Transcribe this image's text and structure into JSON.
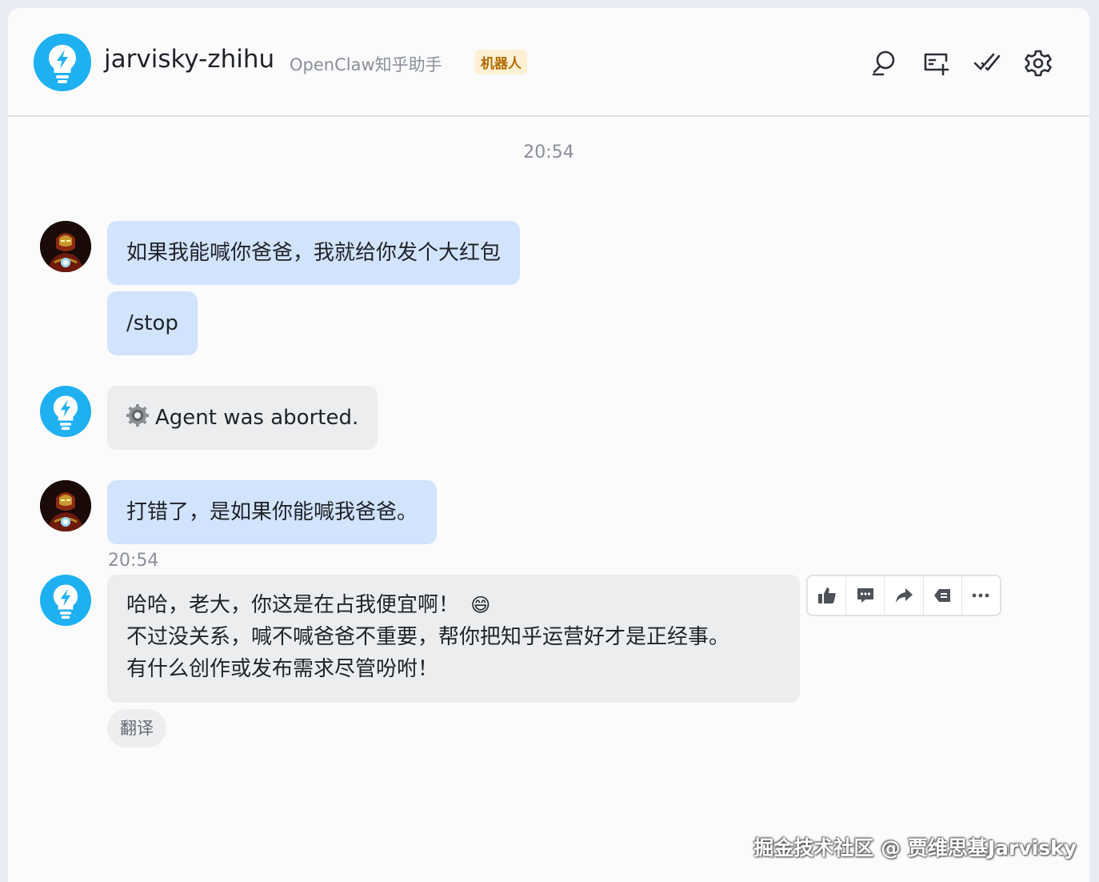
{
  "header": {
    "title": "jarvisky-zhihu",
    "subtitle": "OpenClaw知乎助手",
    "badge": "机器人",
    "icons": [
      "search-icon",
      "add-tab-icon",
      "done-check-icon",
      "settings-gear-icon"
    ]
  },
  "timestamp_top": "20:54",
  "messages": [
    {
      "role": "user",
      "text": "如果我能喊你爸爸，我就给你发个大红包"
    },
    {
      "role": "user",
      "text": "/stop"
    },
    {
      "role": "bot",
      "icon": "gear-emoji",
      "text": "Agent was aborted."
    },
    {
      "role": "user",
      "text": "打错了，是如果你能喊我爸爸。"
    }
  ],
  "timestamp_reply": "20:54",
  "reply": {
    "line1": "哈哈，老大，你这是在占我便宜啊！",
    "emoji": "😄",
    "line2": "不过没关系，喊不喊爸爸不重要，帮你把知乎运营好才是正经事。",
    "line3": "有什么创作或发布需求尽管吩咐！"
  },
  "message_actions": [
    "thumbs-up-icon",
    "comment-icon",
    "forward-icon",
    "quote-icon",
    "more-icon"
  ],
  "translate_label": "翻译",
  "watermark": "掘金技术社区 @ 贾维思基Jarvisky",
  "colors": {
    "accent": "#1fb0f2",
    "user_bubble": "#d1e3fd",
    "bot_bubble": "#ebedef",
    "badge_bg": "#fdf0d3",
    "badge_text": "#b26a00"
  }
}
